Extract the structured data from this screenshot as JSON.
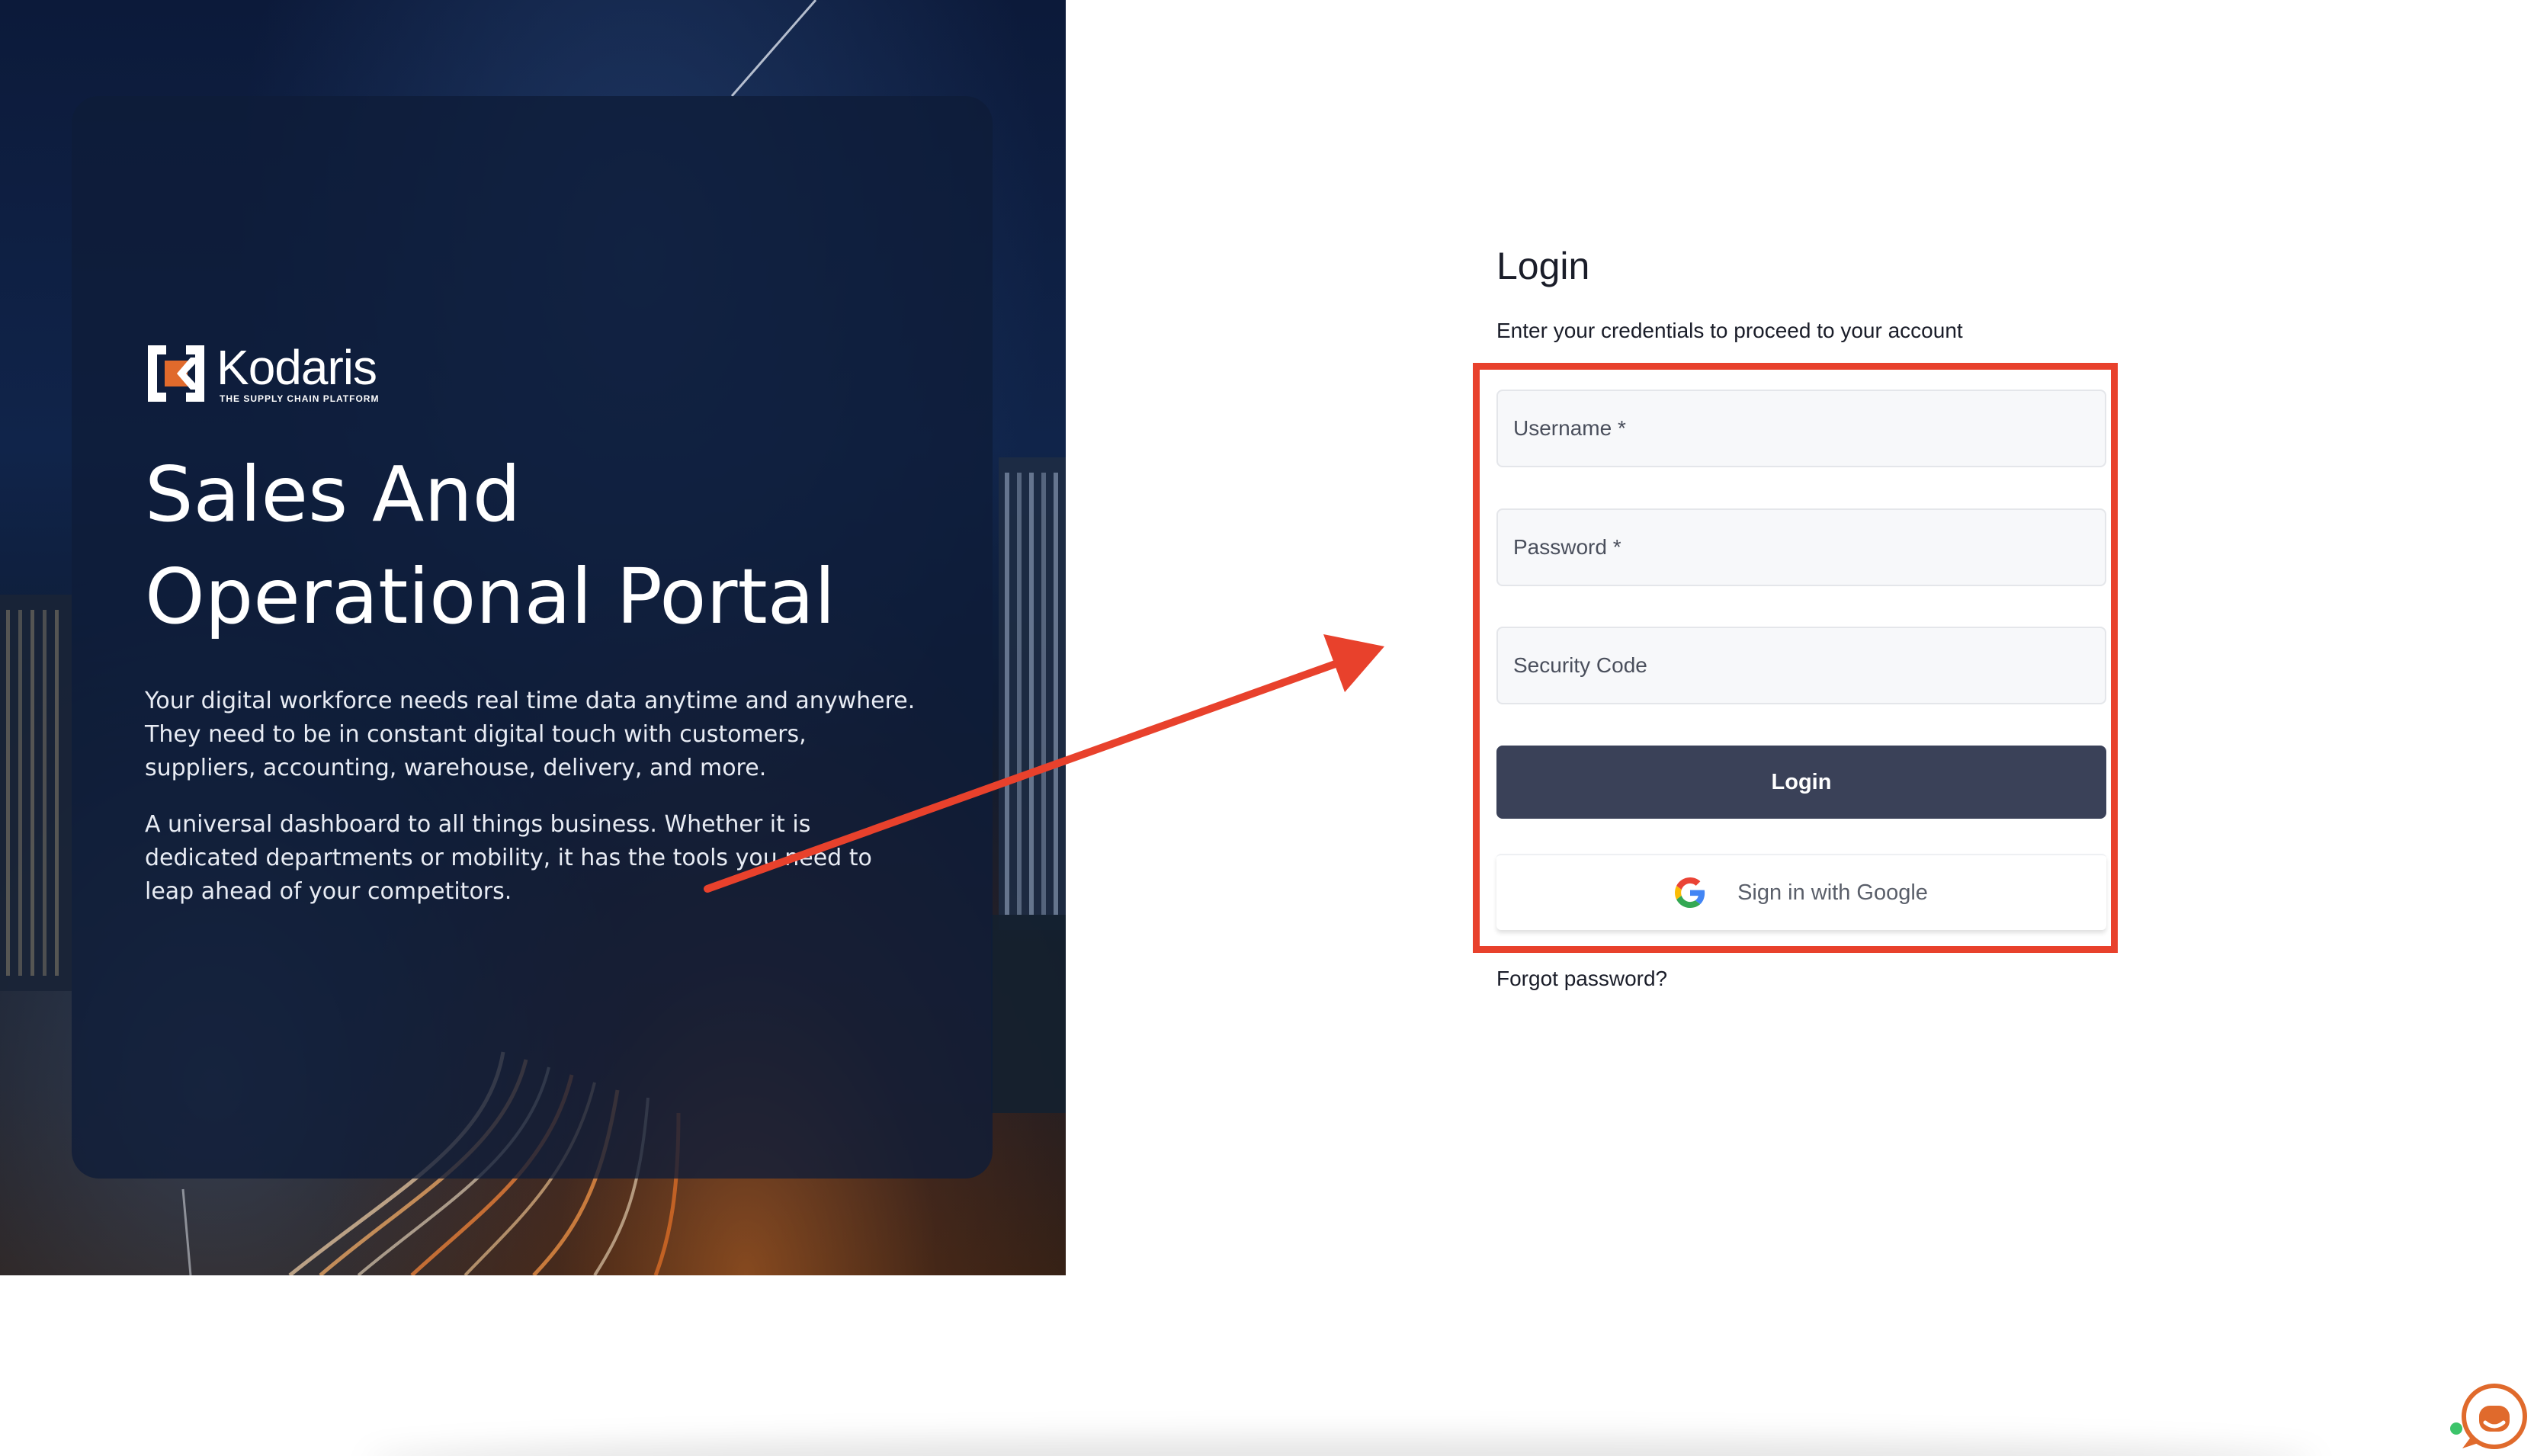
{
  "brand": {
    "name": "Kodaris",
    "tagline": "THE SUPPLY CHAIN PLATFORM",
    "accent_color": "#e06a2c"
  },
  "hero": {
    "title_line1": "Sales And",
    "title_line2": "Operational Portal",
    "paragraph1": "Your digital workforce needs real time data anytime and anywhere. They need to be in constant digital touch with customers, suppliers, accounting, warehouse, delivery, and more.",
    "paragraph2": "A universal dashboard to all things business. Whether it is dedicated departments or mobility, it has the tools you need to leap ahead of your competitors."
  },
  "login": {
    "title": "Login",
    "subtitle": "Enter your credentials to proceed to your account",
    "username": {
      "placeholder": "Username *",
      "value": ""
    },
    "password": {
      "placeholder": "Password *",
      "value": ""
    },
    "security_code": {
      "placeholder": "Security Code",
      "value": ""
    },
    "login_button": "Login",
    "login_button_color": "#3a4158",
    "google_button": "Sign in with Google",
    "google_icon": "google-g-icon",
    "forgot_password": "Forgot password?"
  },
  "annotation": {
    "color": "#e8412c",
    "type": "arrow-and-box"
  },
  "chat_widget": {
    "icon": "chat-support-icon",
    "color": "#e06a2c"
  }
}
